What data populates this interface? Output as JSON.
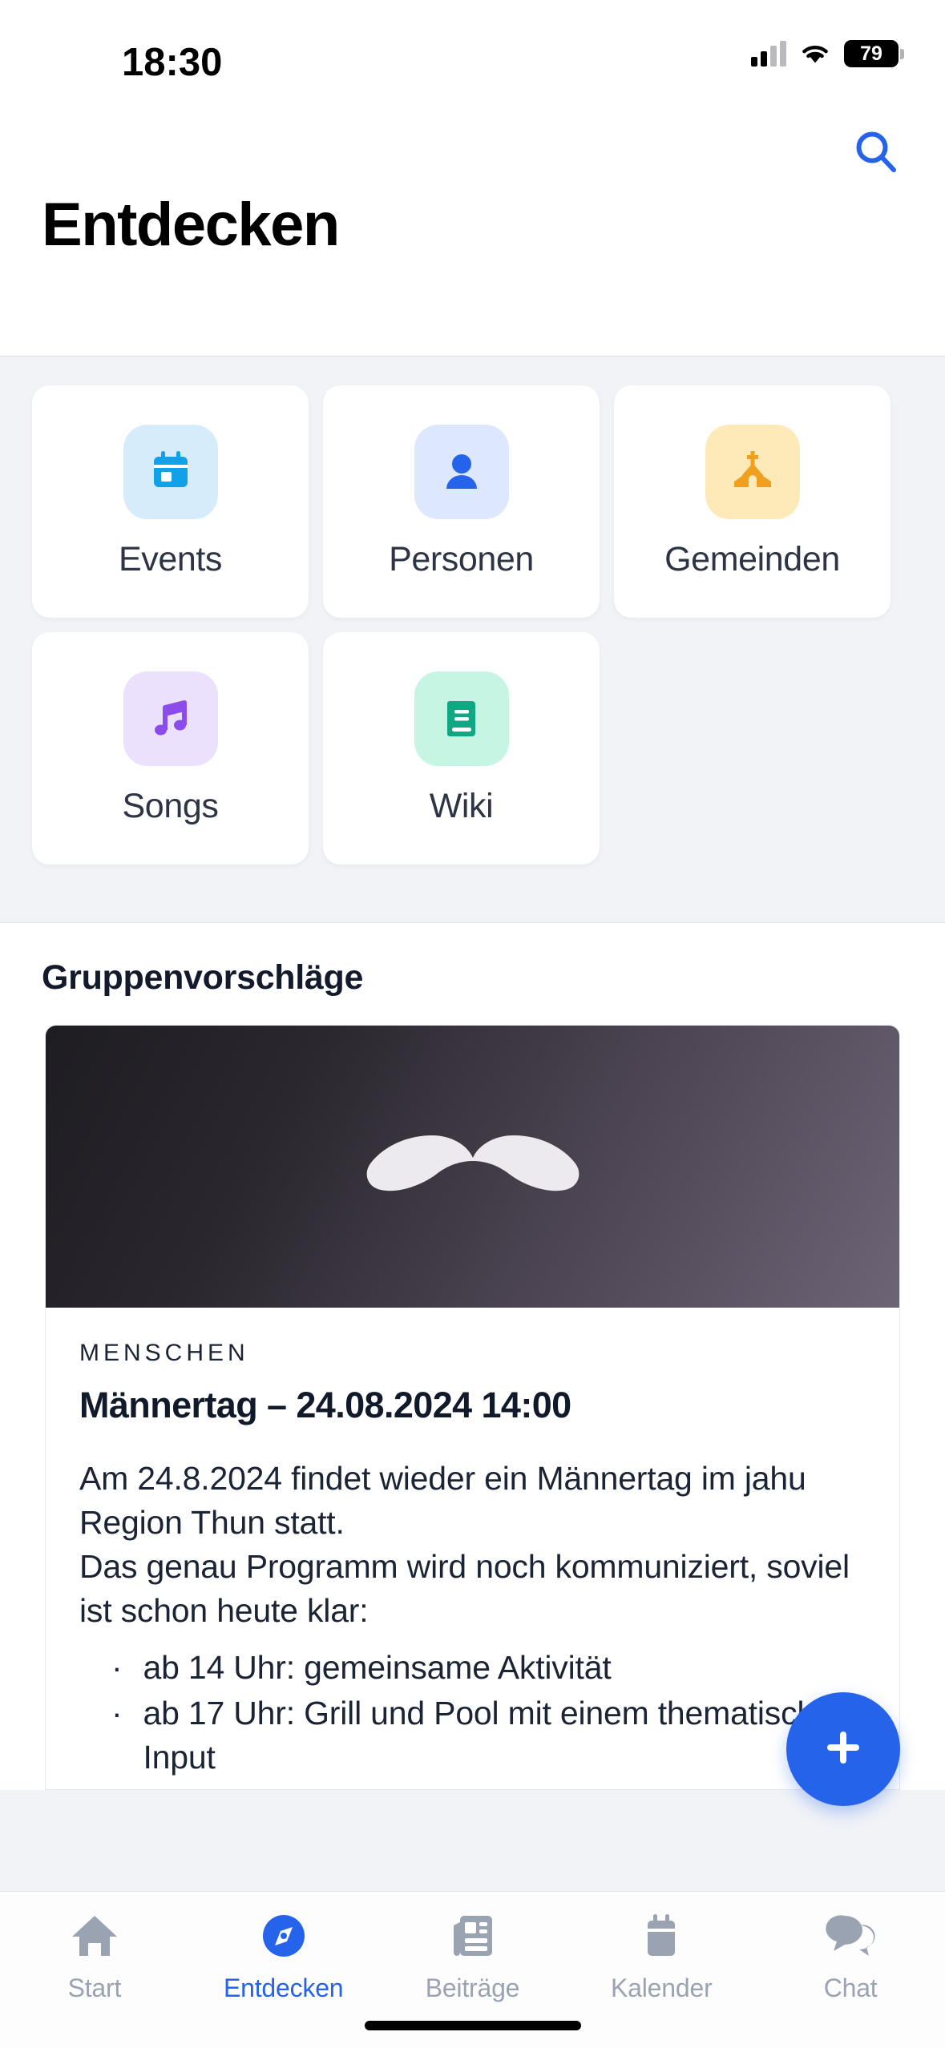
{
  "statusbar": {
    "time": "18:30",
    "battery_level": "79",
    "signal_icon": "cellular-signal-icon",
    "wifi_icon": "wifi-icon",
    "battery_icon": "battery-icon"
  },
  "navbar": {
    "title": "Entdecken",
    "search_icon": "search-icon"
  },
  "tiles": [
    {
      "label": "Events",
      "icon": "calendar-icon",
      "icon_bg": "#d6ecfb",
      "icon_color": "#12a0e8"
    },
    {
      "label": "Personen",
      "icon": "person-icon",
      "icon_bg": "#dde7fd",
      "icon_color": "#2563eb"
    },
    {
      "label": "Gemeinden",
      "icon": "church-icon",
      "icon_bg": "#fdeab8",
      "icon_color": "#f0a01e"
    },
    {
      "label": "Songs",
      "icon": "music-note-icon",
      "icon_bg": "#ece1fd",
      "icon_color": "#8b4ceb"
    },
    {
      "label": "Wiki",
      "icon": "book-icon",
      "icon_bg": "#c6f5e4",
      "icon_color": "#0fa882"
    }
  ],
  "suggestions": {
    "section_title": "Gruppenvorschläge",
    "card": {
      "hero_icon": "moustache-icon",
      "kicker": "MENSCHEN",
      "heading": "Männertag – 24.08.2024 14:00",
      "paragraph_1": "Am 24.8.2024 findet wieder ein Männertag im jahu Region Thun statt.",
      "paragraph_2": "Das genau Programm wird noch kommuniziert, soviel ist schon heute klar:",
      "bullets": [
        "ab 14 Uhr: gemeinsame Aktivität",
        "ab 17 Uhr: Grill und Pool mit einem thematischen Input"
      ],
      "bullet_marker": "·"
    }
  },
  "fab": {
    "label": "+",
    "icon": "plus-icon",
    "color": "#2563eb"
  },
  "tabbar": {
    "active_index": 1,
    "tabs": [
      {
        "label": "Start",
        "icon": "home-icon"
      },
      {
        "label": "Entdecken",
        "icon": "compass-icon"
      },
      {
        "label": "Beiträge",
        "icon": "newspaper-icon"
      },
      {
        "label": "Kalender",
        "icon": "calendar-icon"
      },
      {
        "label": "Chat",
        "icon": "chat-bubbles-icon"
      }
    ]
  },
  "colors": {
    "accent": "#2563eb",
    "page_bg": "#f1f3f7",
    "text_dark": "#111a2b",
    "text_muted": "#9aa3b2"
  }
}
